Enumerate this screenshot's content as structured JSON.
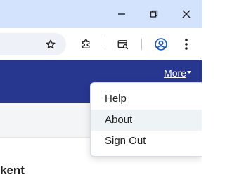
{
  "window_controls": {
    "minimize_icon": "minimize-icon",
    "restore_icon": "restore-icon",
    "close_icon": "close-icon"
  },
  "toolbar": {
    "icons": [
      "star-icon",
      "extensions-icon",
      "tab-search-icon",
      "profile-icon",
      "kebab-menu-icon"
    ]
  },
  "header": {
    "more_label": "More",
    "background_color": "#27378f"
  },
  "dropdown": {
    "items": [
      {
        "label": "Help"
      },
      {
        "label": "About"
      },
      {
        "label": "Sign Out"
      }
    ],
    "hovered_item": "About"
  },
  "page": {
    "heading_fragment": "kent"
  }
}
